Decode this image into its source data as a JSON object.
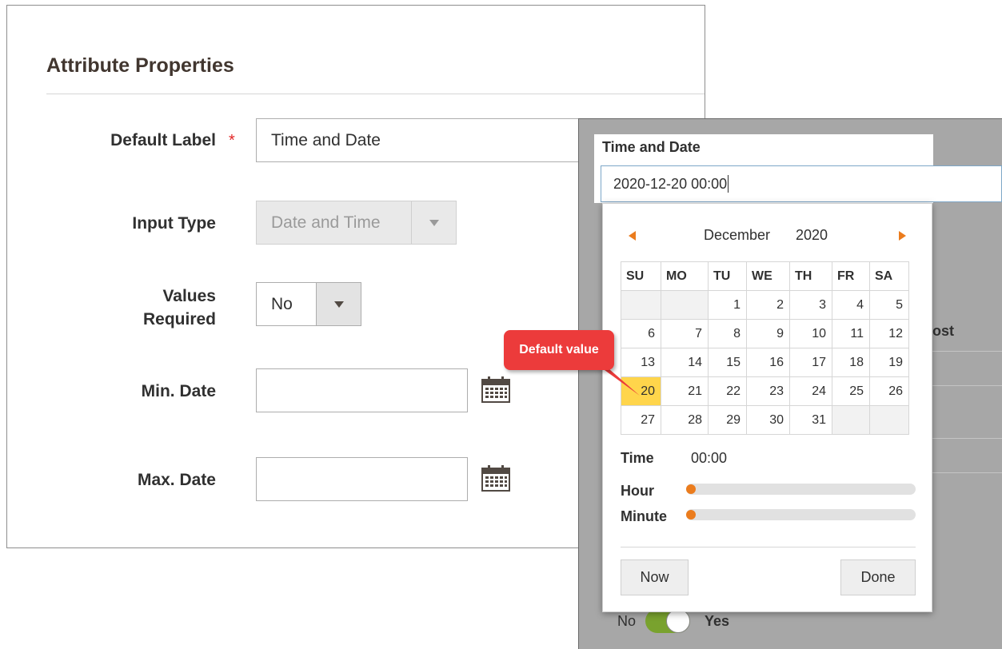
{
  "form": {
    "title": "Attribute Properties",
    "default_label": {
      "label": "Default Label",
      "required_mark": "*",
      "value": "Time and Date"
    },
    "input_type": {
      "label": "Input Type",
      "value": "Date and Time"
    },
    "values_required": {
      "label_line1": "Values",
      "label_line2": "Required",
      "value": "No"
    },
    "min_date": {
      "label": "Min. Date",
      "value": ""
    },
    "max_date": {
      "label": "Max. Date",
      "value": ""
    }
  },
  "preview": {
    "field_label": "Time and Date",
    "field_value": "2020-12-20 00:00",
    "background_fragment": "ost",
    "toggle": {
      "off_label": "No",
      "on_label": "Yes"
    }
  },
  "datepicker": {
    "month": "December",
    "year": "2020",
    "weekdays": [
      "SU",
      "MO",
      "TU",
      "WE",
      "TH",
      "FR",
      "SA"
    ],
    "weeks": [
      [
        "",
        "",
        "1",
        "2",
        "3",
        "4",
        "5"
      ],
      [
        "6",
        "7",
        "8",
        "9",
        "10",
        "11",
        "12"
      ],
      [
        "13",
        "14",
        "15",
        "16",
        "17",
        "18",
        "19"
      ],
      [
        "20",
        "21",
        "22",
        "23",
        "24",
        "25",
        "26"
      ],
      [
        "27",
        "28",
        "29",
        "30",
        "31",
        "",
        ""
      ]
    ],
    "selected_day": "20",
    "time_label": "Time",
    "time_value": "00:00",
    "hour_label": "Hour",
    "minute_label": "Minute",
    "hour_value": 0,
    "minute_value": 0,
    "now_button": "Now",
    "done_button": "Done"
  },
  "callout": {
    "text": "Default value"
  },
  "colors": {
    "accent": "#eb7c1d",
    "required": "#e22626",
    "callout": "#ec3b3b",
    "selected_day": "#ffd54b",
    "toggle_on": "#79a22e"
  }
}
